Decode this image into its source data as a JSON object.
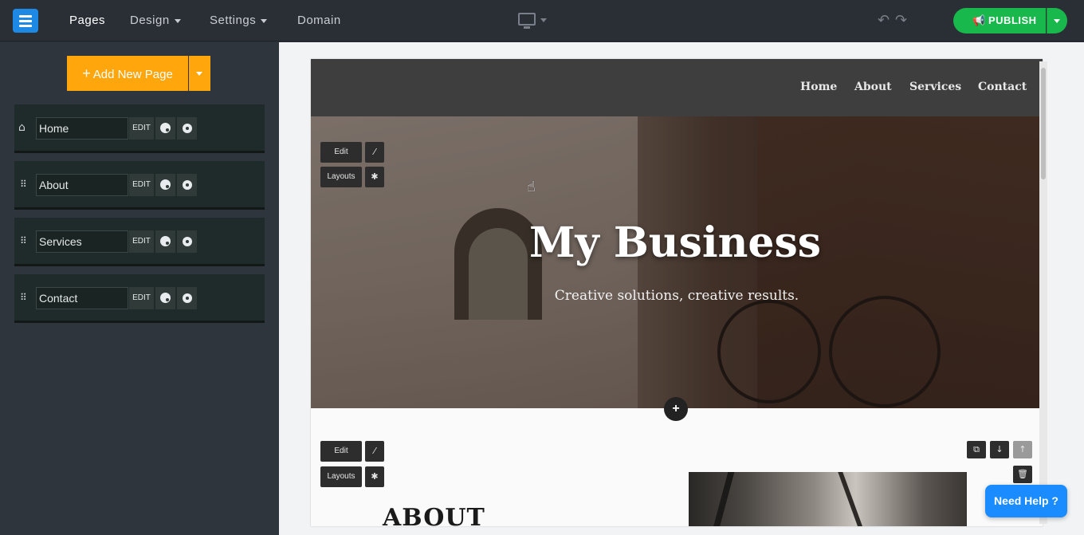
{
  "topbar": {
    "nav": [
      "Pages",
      "Design",
      "Settings",
      "Domain"
    ],
    "publish_label": "PUBLISH",
    "publish_color": "#19b84c"
  },
  "sidebar": {
    "add_page_label": "Add New Page",
    "add_page_color": "#ffa60d",
    "pages": [
      {
        "name": "Home",
        "edit": "EDIT"
      },
      {
        "name": "About",
        "edit": "EDIT"
      },
      {
        "name": "Services",
        "edit": "EDIT"
      },
      {
        "name": "Contact",
        "edit": "EDIT"
      }
    ]
  },
  "site": {
    "nav": [
      "Home",
      "About",
      "Services",
      "Contact"
    ],
    "hero_title": "My Business",
    "hero_subtitle": "Creative solutions, creative results.",
    "hero_tools": {
      "edit": "Edit",
      "layouts": "Layouts"
    },
    "about_tools": {
      "edit": "Edit",
      "layouts": "Layouts"
    },
    "about_heading": "ABOUT"
  },
  "help_label": "Need Help ?"
}
